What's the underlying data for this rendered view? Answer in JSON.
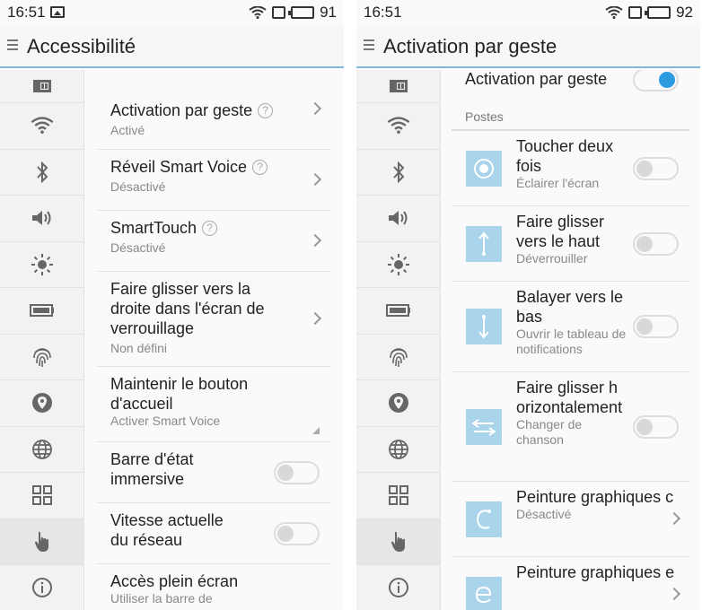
{
  "left": {
    "status": {
      "time": "16:51",
      "battery": "91"
    },
    "title": "Accessibilité",
    "sidebar_icons": [
      "sim-icon",
      "wifi-icon",
      "bluetooth-icon",
      "volume-icon",
      "brightness-icon",
      "battery-icon",
      "fingerprint-icon",
      "location-icon",
      "globe-icon",
      "apps-grid-icon",
      "hand-touch-icon",
      "info-icon"
    ],
    "items": [
      {
        "title": "Activation par geste",
        "subtitle": "Activé",
        "help": "?"
      },
      {
        "title": "Réveil Smart Voice",
        "subtitle": "Désactivé",
        "help": "?"
      },
      {
        "title": "SmartTouch",
        "subtitle": "Désactivé",
        "help": "?"
      },
      {
        "title": "Faire glisser vers la droite dans l'écran de verrouillage",
        "subtitle": "Non défini"
      },
      {
        "title": "Maintenir le bouton d'accueil",
        "subtitle": "Activer Smart Voice"
      },
      {
        "title": "Barre d'état immersive",
        "toggle": "off"
      },
      {
        "title": "Vitesse actuelle du réseau",
        "toggle": "off"
      },
      {
        "title": "Accès plein écran",
        "subtitle": "Utiliser la barre de",
        "toggle": "on"
      }
    ]
  },
  "right": {
    "status": {
      "time": "16:51",
      "battery": "92"
    },
    "title": "Activation par geste",
    "main_toggle_label": "Activation par geste",
    "section": "Postes",
    "items": [
      {
        "title": "Toucher deux fois",
        "subtitle": "Éclairer l'écran",
        "toggle": "off"
      },
      {
        "title": "Faire glisser vers le haut",
        "subtitle": "Déverrouiller",
        "toggle": "off"
      },
      {
        "title": "Balayer vers le bas",
        "subtitle": "Ouvrir le tableau de notifications",
        "toggle": "off"
      },
      {
        "title": "Faire glisser horizontalement",
        "subtitle": "Changer de chanson",
        "toggle": "off"
      },
      {
        "title": "Peinture graphiques c",
        "subtitle": "Désactivé"
      },
      {
        "title": "Peinture graphiques e",
        "subtitle": ""
      }
    ]
  },
  "colors": {
    "accent": "#2e9be0",
    "thumb": "#a9d4ec",
    "divider": "#7fb8d8"
  }
}
